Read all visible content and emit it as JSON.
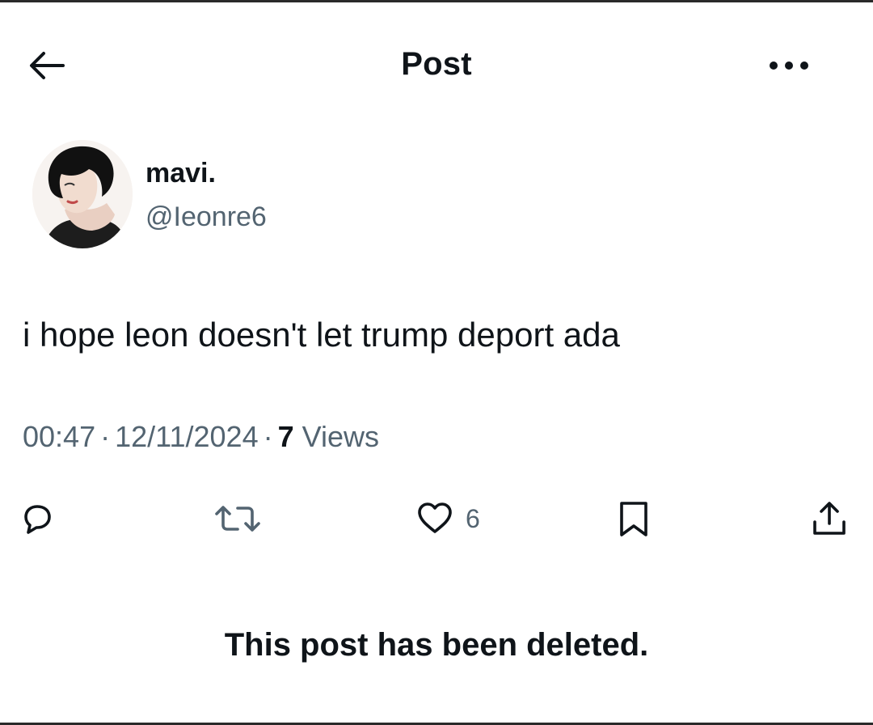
{
  "header": {
    "title": "Post",
    "back_icon": "arrow-left-icon",
    "more_icon": "ellipsis-icon"
  },
  "author": {
    "display_name": "mavi.",
    "handle": "@Ieonre6"
  },
  "post": {
    "text": "i hope leon doesn't let trump deport ada",
    "time": "00:47",
    "date": "12/11/2024",
    "separator": "·",
    "views_count": "7",
    "views_label": "Views"
  },
  "actions": {
    "reply_icon": "reply-bubble-icon",
    "repost_icon": "repost-icon",
    "like_icon": "heart-icon",
    "like_count": "6",
    "bookmark_icon": "bookmark-icon",
    "share_icon": "share-upload-icon"
  },
  "notice": {
    "text": "This post has been deleted."
  },
  "colors": {
    "text": "#0f1419",
    "secondary_text": "#536471",
    "background": "#ffffff"
  }
}
